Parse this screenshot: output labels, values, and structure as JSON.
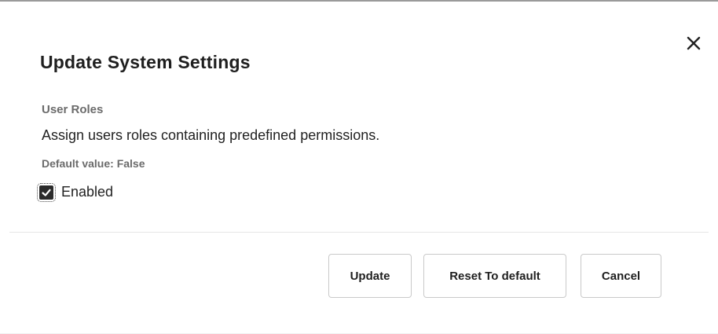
{
  "dialog": {
    "title": "Update System Settings",
    "close_icon": "close-icon"
  },
  "setting": {
    "label": "User Roles",
    "description": "Assign users roles containing predefined permissions.",
    "default_value": "Default value: False",
    "checkbox": {
      "label": "Enabled",
      "checked": true,
      "icon": "checkmark-icon"
    }
  },
  "buttons": {
    "update": "Update",
    "reset": "Reset To default",
    "cancel": "Cancel"
  }
}
